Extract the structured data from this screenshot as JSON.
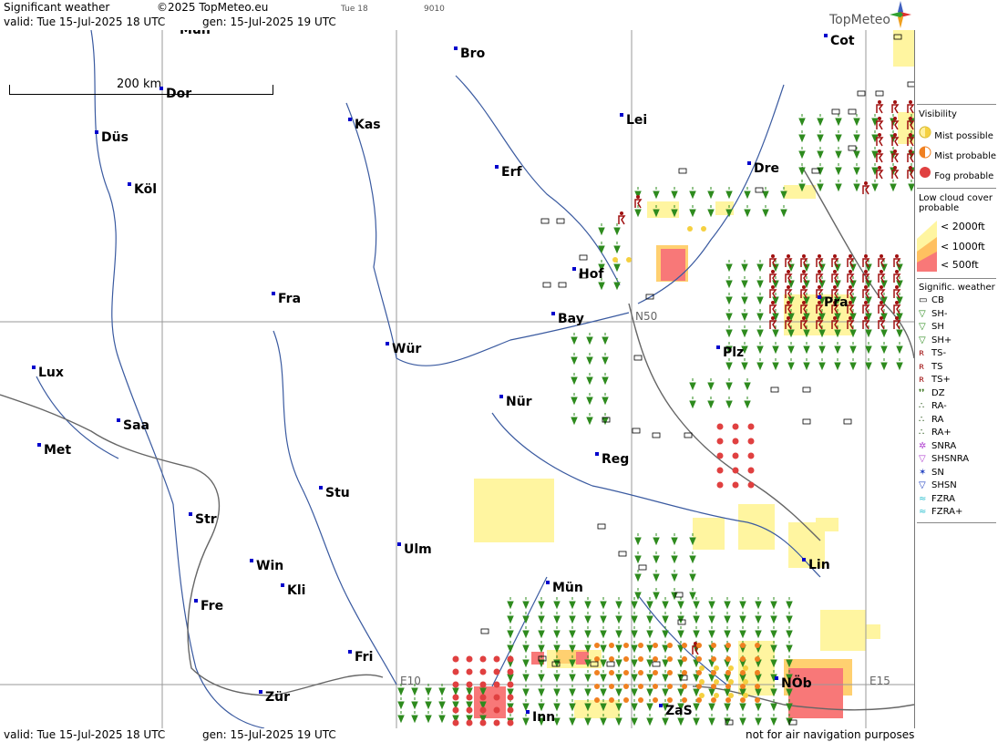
{
  "header": {
    "title": "Significant weather",
    "copyright": "©2025 TopMeteo.eu",
    "valid": "valid:  Tue  15-Jul-2025  18 UTC",
    "gen": "gen: 15-Jul-2025 19 UTC",
    "small1": "Tue 18",
    "small2": "9010",
    "logo": "TopMeteo"
  },
  "map": {
    "scale_label": "200 km",
    "grid_labels": [
      "N50",
      "E10",
      "E15"
    ],
    "cities": [
      {
        "name": "Mün",
        "id": "mun-top"
      },
      {
        "name": "Bro"
      },
      {
        "name": "Cot"
      },
      {
        "name": "Dor"
      },
      {
        "name": "Kas"
      },
      {
        "name": "Lei"
      },
      {
        "name": "Düs"
      },
      {
        "name": "Dre"
      },
      {
        "name": "Erf"
      },
      {
        "name": "Köl"
      },
      {
        "name": "Hof"
      },
      {
        "name": "Pra"
      },
      {
        "name": "Fra"
      },
      {
        "name": "Bay"
      },
      {
        "name": "Lux"
      },
      {
        "name": "Wür"
      },
      {
        "name": "Plz"
      },
      {
        "name": "Nür"
      },
      {
        "name": "Saa"
      },
      {
        "name": "Met"
      },
      {
        "name": "Reg"
      },
      {
        "name": "Stu"
      },
      {
        "name": "Str"
      },
      {
        "name": "Ulm"
      },
      {
        "name": "Win"
      },
      {
        "name": "Lin"
      },
      {
        "name": "Kli"
      },
      {
        "name": "Mün"
      },
      {
        "name": "Fre"
      },
      {
        "name": "Fri"
      },
      {
        "name": "NÖb"
      },
      {
        "name": "Zür"
      },
      {
        "name": "ZaS"
      },
      {
        "name": "Inn"
      }
    ]
  },
  "footer": {
    "valid": "valid:  Tue  15-Jul-2025  18 UTC",
    "gen": "gen: 15-Jul-2025 19 UTC",
    "note": "not for air navigation purposes"
  },
  "legend": {
    "visibility_title": "Visibility",
    "mist_possible": "Mist possible",
    "mist_probable": "Mist probable",
    "fog_probable": "Fog probable",
    "lowcloud_title": "Low cloud cover probable",
    "lc1": "< 2000ft",
    "lc2": "< 1000ft",
    "lc3": "<   500ft",
    "sigwx_title": "Signific. weather",
    "items": [
      "CB",
      "SH-",
      "SH",
      "SH+",
      "TS-",
      "TS",
      "TS+",
      "DZ",
      "RA-",
      "RA",
      "RA+",
      "SNRA",
      "SHSNRA",
      "SN",
      "SHSN",
      "FZRA",
      "FZRA+"
    ],
    "colors": {
      "shower": "#2e8b1e",
      "ts": "#a01010",
      "fog": "#e05050",
      "mist": "#f5d040",
      "mistprob": "#f08020",
      "lowcloud": "#fff5a0",
      "snow": "#b040d0",
      "sn": "#2040c0",
      "fzra": "#30c0d0"
    }
  }
}
